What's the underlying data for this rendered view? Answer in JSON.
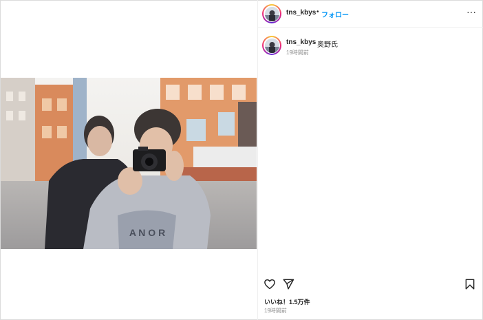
{
  "header": {
    "username": "tns_kbys",
    "separator": "•",
    "follow_label": "フォロー",
    "more_icon": "more-horizontal-icon",
    "more_label": "···"
  },
  "caption": {
    "username": "tns_kbys",
    "text": "奥野氏",
    "time": "19時間前"
  },
  "actions": {
    "like_icon": "heart-icon",
    "share_icon": "paper-plane-icon",
    "save_icon": "bookmark-icon"
  },
  "likes": "いいね！1.5万件",
  "post_time": "19時間前",
  "colors": {
    "accent": "#0095f6",
    "text": "#262626",
    "secondary": "#8e8e8e"
  }
}
